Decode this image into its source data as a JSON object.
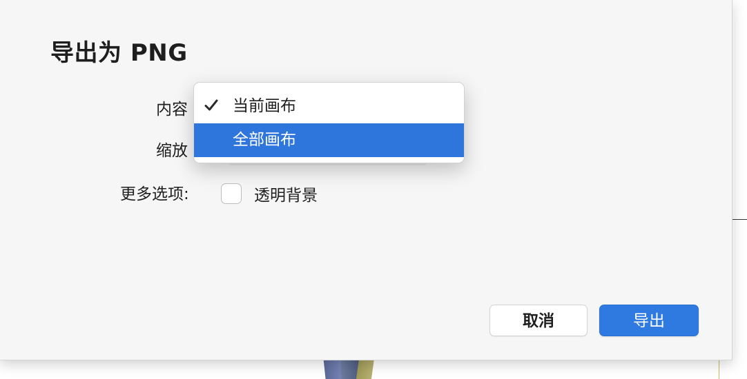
{
  "dialog": {
    "title": "导出为 PNG"
  },
  "form": {
    "content_label": "内容",
    "scale_label": "缩放",
    "more_options_label": "更多选项:",
    "transparent_bg": {
      "label": "透明背景",
      "checked": false
    }
  },
  "content_menu": {
    "items": [
      {
        "label": "当前画布",
        "selected": true,
        "icon": "checkmark-icon"
      },
      {
        "label": "全部画布",
        "highlighted": true
      }
    ]
  },
  "buttons": {
    "cancel_label": "取消",
    "export_label": "导出"
  },
  "colors": {
    "accent": "#2f7ae0",
    "menu_highlight": "#2f76dc",
    "sheet_bg": "#f6f6f6"
  }
}
